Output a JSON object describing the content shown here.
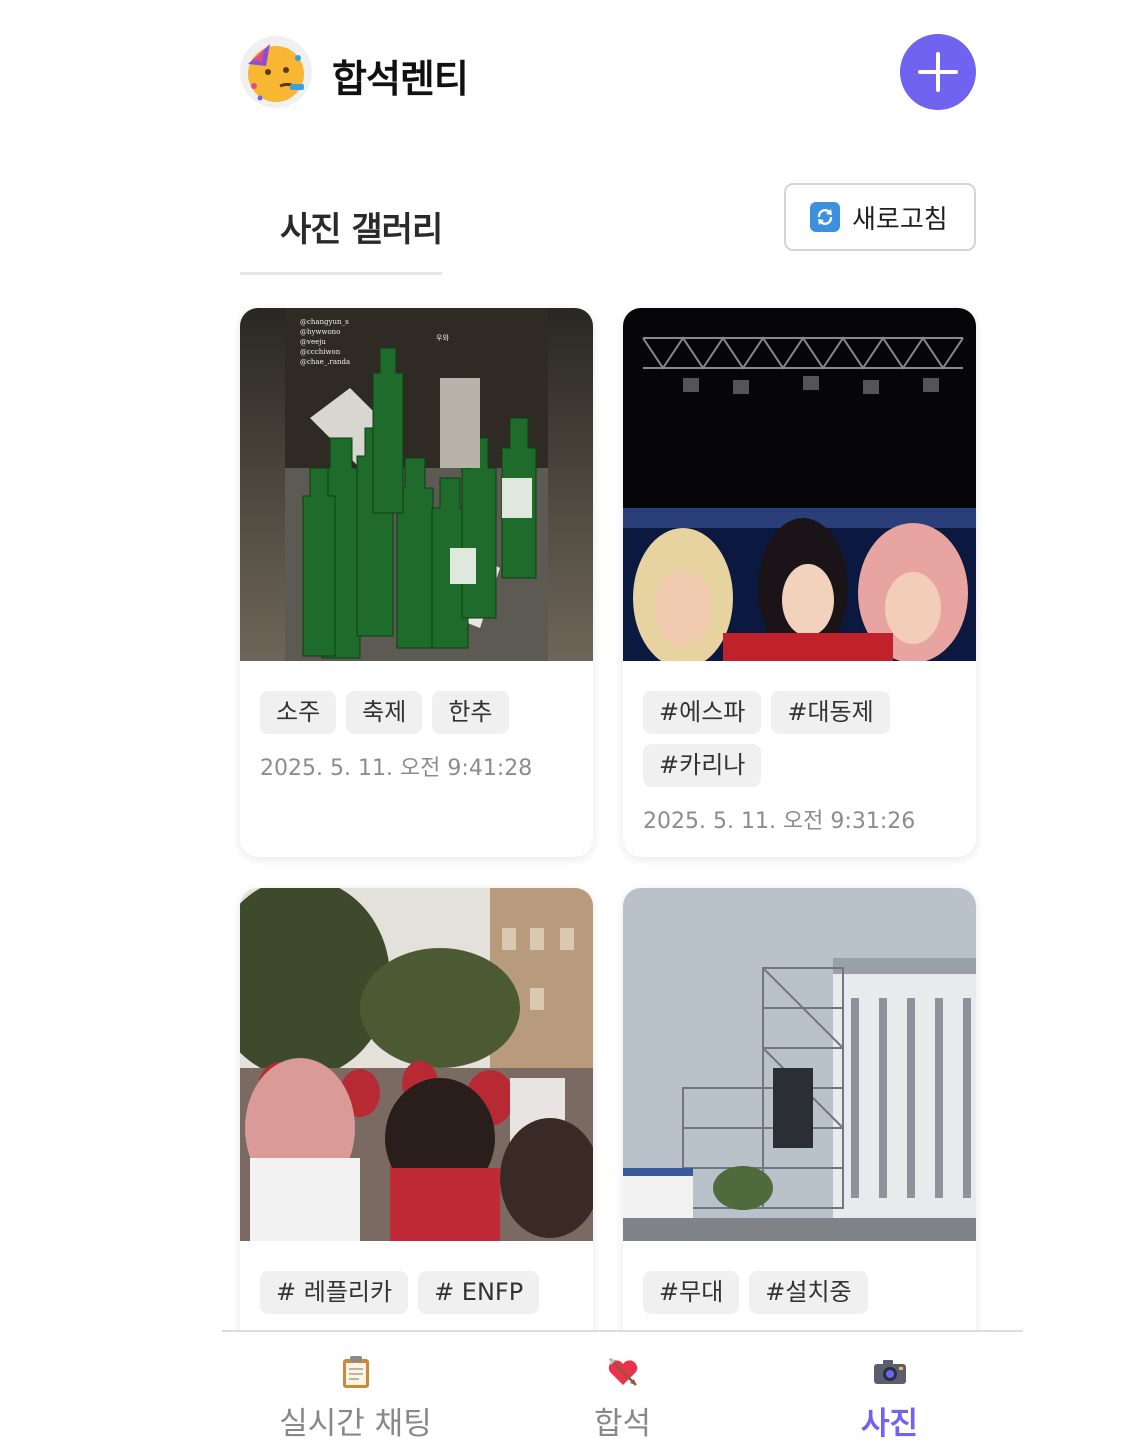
{
  "header": {
    "title": "합석렌티",
    "logo_icon": "partying-face-icon",
    "add_icon": "plus-icon"
  },
  "gallery": {
    "title": "사진 갤러리",
    "refresh_label": "새로고침",
    "refresh_icon": "refresh-icon"
  },
  "posts": [
    {
      "tags": [
        "소주",
        "축제",
        "한추"
      ],
      "date": "2025. 5. 11. 오전 9:41:28",
      "photo_text": [
        "@changyun_s",
        "@hywwono",
        "@veeju",
        "@ccchiwon",
        "@chae_.randa",
        "우와"
      ]
    },
    {
      "tags": [
        "#에스파",
        "#대동제",
        "#카리나"
      ],
      "date": "2025. 5. 11. 오전 9:31:26"
    },
    {
      "tags": [
        "# 레플리카",
        "# ENFP"
      ],
      "date": ""
    },
    {
      "tags": [
        "#무대",
        "#설치중"
      ],
      "date": ""
    }
  ],
  "nav": {
    "items": [
      {
        "label": "실시간 채팅",
        "icon": "clipboard-icon"
      },
      {
        "label": "합석",
        "icon": "heart-arrow-icon"
      },
      {
        "label": "사진",
        "icon": "camera-icon"
      }
    ],
    "active_index": 2
  },
  "colors": {
    "accent": "#6f63f0",
    "tag_bg": "#f0f0f0",
    "date_text": "#8c8c8c"
  }
}
